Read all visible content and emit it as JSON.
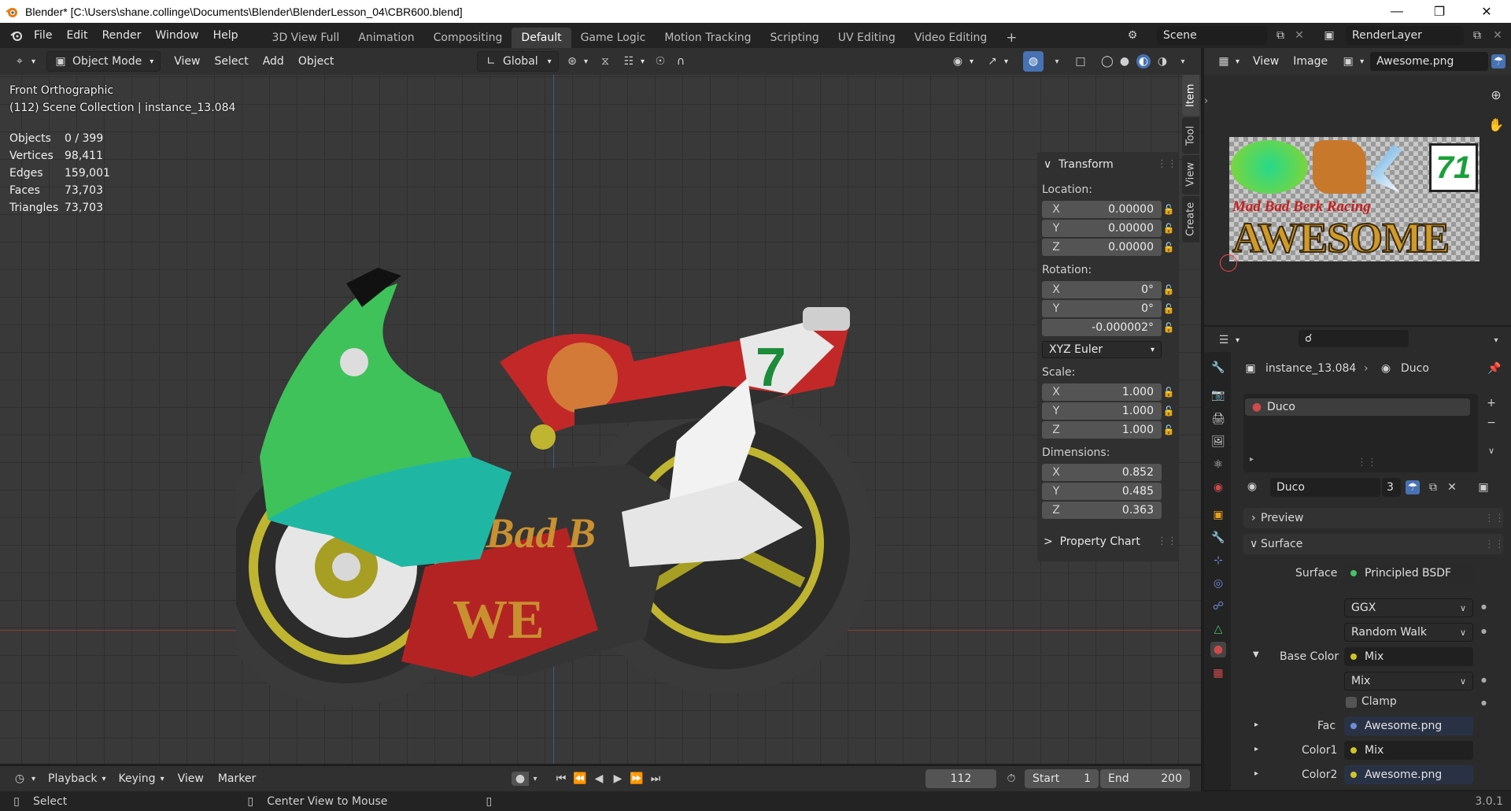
{
  "title_bar": {
    "title": "Blender* [C:\\Users\\shane.collinge\\Documents\\Blender\\BlenderLesson_04\\CBR600.blend]"
  },
  "menu": {
    "items": [
      "File",
      "Edit",
      "Render",
      "Window",
      "Help"
    ]
  },
  "workspaces": {
    "tabs": [
      "3D View Full",
      "Animation",
      "Compositing",
      "Default",
      "Game Logic",
      "Motion Tracking",
      "Scripting",
      "UV Editing",
      "Video Editing"
    ],
    "active": "Default",
    "add": "+"
  },
  "scene": {
    "label": "Scene",
    "render_layer": "RenderLayer"
  },
  "viewport_header": {
    "mode": "Object Mode",
    "menus": [
      "View",
      "Select",
      "Add",
      "Object"
    ],
    "orientation": "Global"
  },
  "viewport": {
    "view_name": "Front Orthographic",
    "collection": "(112) Scene Collection | instance_13.084",
    "stats": [
      {
        "key": "Objects",
        "value": "0 / 399"
      },
      {
        "key": "Vertices",
        "value": "98,411"
      },
      {
        "key": "Edges",
        "value": "159,001"
      },
      {
        "key": "Faces",
        "value": "73,703"
      },
      {
        "key": "Triangles",
        "value": "73,703"
      }
    ]
  },
  "npanel": {
    "transform_label": "Transform",
    "location_label": "Location:",
    "location": [
      {
        "axis": "X",
        "value": "0.00000"
      },
      {
        "axis": "Y",
        "value": "0.00000"
      },
      {
        "axis": "Z",
        "value": "0.00000"
      }
    ],
    "rotation_label": "Rotation:",
    "rotation": [
      {
        "axis": "X",
        "value": "0°"
      },
      {
        "axis": "Y",
        "value": "0°"
      },
      {
        "axis": "",
        "value": "-0.000002°"
      }
    ],
    "rotation_mode": "XYZ Euler",
    "scale_label": "Scale:",
    "scale": [
      {
        "axis": "X",
        "value": "1.000"
      },
      {
        "axis": "Y",
        "value": "1.000"
      },
      {
        "axis": "Z",
        "value": "1.000"
      }
    ],
    "dimensions_label": "Dimensions:",
    "dimensions": [
      {
        "axis": "X",
        "value": "0.852"
      },
      {
        "axis": "Y",
        "value": "0.485"
      },
      {
        "axis": "Z",
        "value": "0.363"
      }
    ],
    "property_chart_label": "Property Chart",
    "tabs": [
      "Item",
      "Tool",
      "View",
      "Create"
    ]
  },
  "image_editor": {
    "menus": [
      "View",
      "Image"
    ],
    "image_name": "Awesome.png",
    "image_text": {
      "number": "71",
      "subtitle": "Mad Bad Berk Racing",
      "headline": "AWESOME"
    }
  },
  "properties": {
    "breadcrumb_object": "instance_13.084",
    "breadcrumb_material": "Duco",
    "material_slot": "Duco",
    "material_name": "Duco",
    "user_count": "3",
    "sections": {
      "preview": "Preview",
      "surface": "Surface"
    },
    "surface": {
      "surface_label": "Surface",
      "surface_value": "Principled BSDF",
      "distribution": "GGX",
      "subsurface": "Random Walk",
      "base_color_label": "Base Color",
      "base_color_value": "Mix",
      "blend_mode": "Mix",
      "clamp_label": "Clamp",
      "fac_label": "Fac",
      "fac_value": "Awesome.png",
      "color1_label": "Color1",
      "color1_value": "Mix",
      "color2_label": "Color2",
      "color2_value": "Awesome.png"
    }
  },
  "timeline": {
    "menus": [
      "Playback",
      "Keying",
      "View",
      "Marker"
    ],
    "current_frame": "112",
    "start_label": "Start",
    "start": "1",
    "end_label": "End",
    "end": "200"
  },
  "status_bar": {
    "select": "Select",
    "center_view": "Center View to Mouse",
    "version": "3.0.1"
  }
}
